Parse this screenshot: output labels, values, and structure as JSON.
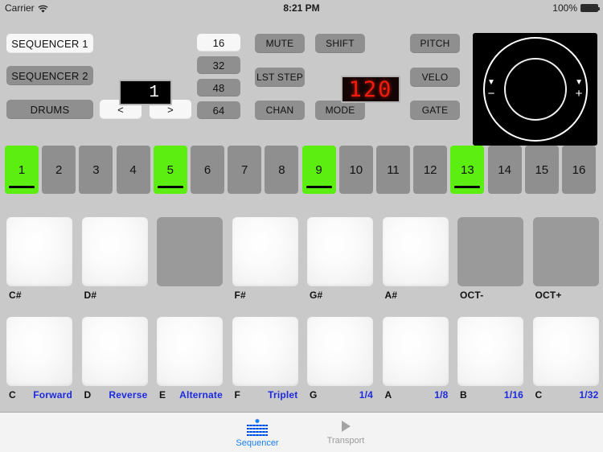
{
  "statusbar": {
    "carrier": "Carrier",
    "wifi_icon": "wifi-icon",
    "time": "8:21 PM",
    "battery_percent": "100%",
    "battery_icon": "battery-full-icon"
  },
  "controls": {
    "sequencer1": "SEQUENCER 1",
    "sequencer2": "SEQUENCER 2",
    "drums": "DRUMS",
    "prev": "<",
    "next": ">",
    "pattern_display": "1",
    "lengths": [
      "16",
      "32",
      "48",
      "64"
    ],
    "length_selected": "16",
    "mute": "MUTE",
    "shift": "SHIFT",
    "pitch": "PITCH",
    "last_step": "LST STEP",
    "velo": "VELO",
    "chan": "CHAN",
    "mode": "MODE",
    "gate": "GATE",
    "bpm_display": "120",
    "wheel": {
      "minus_label": "−",
      "plus_label": "+",
      "minus_arrow": "▼",
      "plus_arrow": "▼"
    }
  },
  "steps": {
    "labels": [
      "1",
      "2",
      "3",
      "4",
      "5",
      "6",
      "7",
      "8",
      "9",
      "10",
      "11",
      "12",
      "13",
      "14",
      "15",
      "16"
    ],
    "active": [
      1,
      5,
      9,
      13
    ],
    "colors": {
      "on": "#5bee10",
      "off": "#8f8f8f"
    }
  },
  "keyboard": {
    "black_row": [
      {
        "label": "C#",
        "alt": "",
        "state": "light"
      },
      {
        "label": "D#",
        "alt": "",
        "state": "light"
      },
      {
        "label": "",
        "alt": "",
        "state": "dim"
      },
      {
        "label": "F#",
        "alt": "",
        "state": "light"
      },
      {
        "label": "G#",
        "alt": "",
        "state": "light"
      },
      {
        "label": "A#",
        "alt": "",
        "state": "light"
      },
      {
        "label": "OCT-",
        "alt": "",
        "state": "dim"
      },
      {
        "label": "OCT+",
        "alt": "",
        "state": "dim"
      }
    ],
    "white_row": [
      {
        "label": "C",
        "alt": "Forward",
        "state": "light"
      },
      {
        "label": "D",
        "alt": "Reverse",
        "state": "light"
      },
      {
        "label": "E",
        "alt": "Alternate",
        "state": "light"
      },
      {
        "label": "F",
        "alt": "Triplet",
        "state": "light"
      },
      {
        "label": "G",
        "alt": "1/4",
        "state": "light"
      },
      {
        "label": "A",
        "alt": "1/8",
        "state": "light"
      },
      {
        "label": "B",
        "alt": "1/16",
        "state": "light"
      },
      {
        "label": "C",
        "alt": "1/32",
        "state": "light"
      }
    ],
    "alt_color": "#1c2ae0"
  },
  "tabbar": {
    "tabs": [
      {
        "label": "Sequencer",
        "icon": "sequencer-grid-icon",
        "active": true
      },
      {
        "label": "Transport",
        "icon": "play-triangle-icon",
        "active": false
      }
    ],
    "active_color": "#1a7ff0",
    "inactive_color": "#9a9a9a"
  }
}
